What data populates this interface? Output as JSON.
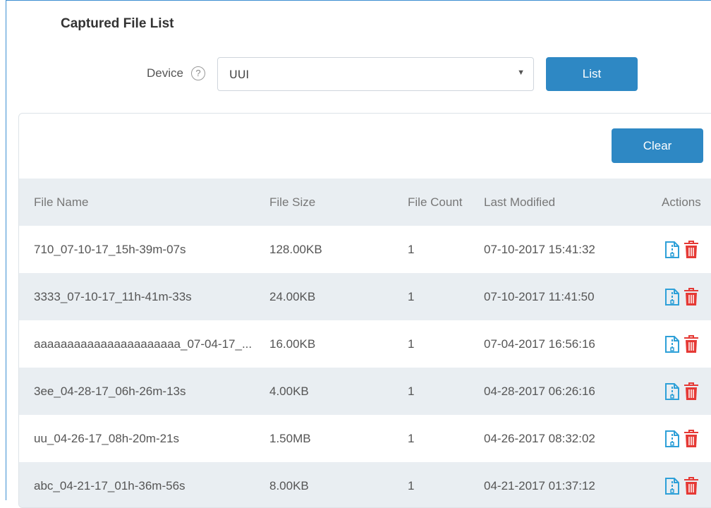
{
  "title": "Captured File List",
  "device": {
    "label": "Device",
    "help": "?",
    "selected": "UUI",
    "list_button": "List"
  },
  "panel": {
    "clear_button": "Clear",
    "columns": [
      "File Name",
      "File Size",
      "File Count",
      "Last Modified",
      "Actions"
    ],
    "rows": [
      {
        "name": "710_07-10-17_15h-39m-07s",
        "size": "128.00KB",
        "count": "1",
        "modified": "07-10-2017 15:41:32"
      },
      {
        "name": "3333_07-10-17_11h-41m-33s",
        "size": "24.00KB",
        "count": "1",
        "modified": "07-10-2017 11:41:50"
      },
      {
        "name": "aaaaaaaaaaaaaaaaaaaaaa_07-04-17_...",
        "size": "16.00KB",
        "count": "1",
        "modified": "07-04-2017 16:56:16"
      },
      {
        "name": "3ee_04-28-17_06h-26m-13s",
        "size": "4.00KB",
        "count": "1",
        "modified": "04-28-2017 06:26:16"
      },
      {
        "name": "uu_04-26-17_08h-20m-21s",
        "size": "1.50MB",
        "count": "1",
        "modified": "04-26-2017 08:32:02"
      },
      {
        "name": "abc_04-21-17_01h-36m-56s",
        "size": "8.00KB",
        "count": "1",
        "modified": "04-21-2017 01:37:12"
      }
    ]
  },
  "colors": {
    "accent": "#2e88c4",
    "download_icon": "#2ea0d8",
    "delete_icon": "#e53935",
    "row_alt": "#e9eef2"
  },
  "icons": {
    "download": "file-download-icon",
    "delete": "trash-icon",
    "help": "help-circle-icon",
    "dropdown": "caret-down-icon"
  }
}
